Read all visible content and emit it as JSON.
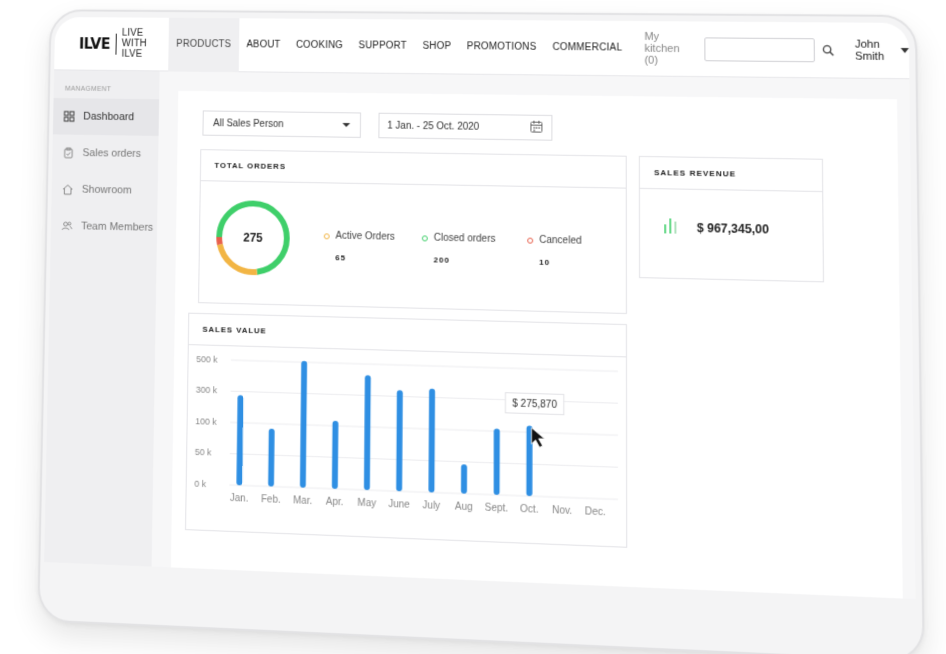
{
  "brand": {
    "logo_text": "ILVE",
    "tagline": "LIVE WITH ILVE"
  },
  "nav": {
    "items": [
      {
        "label": "PRODUCTS",
        "active": true
      },
      {
        "label": "ABOUT"
      },
      {
        "label": "COOKING"
      },
      {
        "label": "SUPPORT"
      },
      {
        "label": "SHOP"
      },
      {
        "label": "PROMOTIONS"
      },
      {
        "label": "COMMERCIAL"
      }
    ],
    "kitchen": "My kitchen (0)",
    "search_placeholder": "",
    "user": "John Smith"
  },
  "sidebar": {
    "section": "MANAGMENT",
    "items": [
      {
        "label": "Dashboard",
        "icon": "grid-icon",
        "active": true
      },
      {
        "label": "Sales orders",
        "icon": "clipboard-icon"
      },
      {
        "label": "Showroom",
        "icon": "home-icon"
      },
      {
        "label": "Team Members",
        "icon": "users-icon"
      }
    ]
  },
  "filters": {
    "sales_person": "All Sales Person",
    "date_range": "1 Jan. - 25 Oct. 2020"
  },
  "orders": {
    "title": "TOTAL ORDERS",
    "total": "275",
    "legend": [
      {
        "label": "Active Orders",
        "value": "65",
        "color": "#f2b544"
      },
      {
        "label": "Closed orders",
        "value": "200",
        "color": "#3fcf6a"
      },
      {
        "label": "Canceled",
        "value": "10",
        "color": "#e8604c"
      }
    ]
  },
  "revenue": {
    "title": "SALES REVENUE",
    "value": "$ 967,345,00",
    "icon": "bar-chart-icon"
  },
  "sales_value": {
    "title": "SALES VALUE",
    "tooltip": "$ 275,870"
  },
  "chart_data": {
    "type": "bar",
    "title": "SALES VALUE",
    "categories": [
      "Jan.",
      "Feb.",
      "Mar.",
      "Apr.",
      "May",
      "June",
      "July",
      "Aug",
      "Sept.",
      "Oct.",
      "Nov.",
      "Dec."
    ],
    "values": [
      360,
      230,
      505,
      270,
      455,
      400,
      410,
      115,
      260,
      275.87,
      null,
      null
    ],
    "y_ticks": [
      "0 k",
      "50 k",
      "100 k",
      "300 k",
      "500 k"
    ],
    "ylim": [
      0,
      500
    ],
    "bar_color": "#2f8fe3",
    "grid": true
  }
}
